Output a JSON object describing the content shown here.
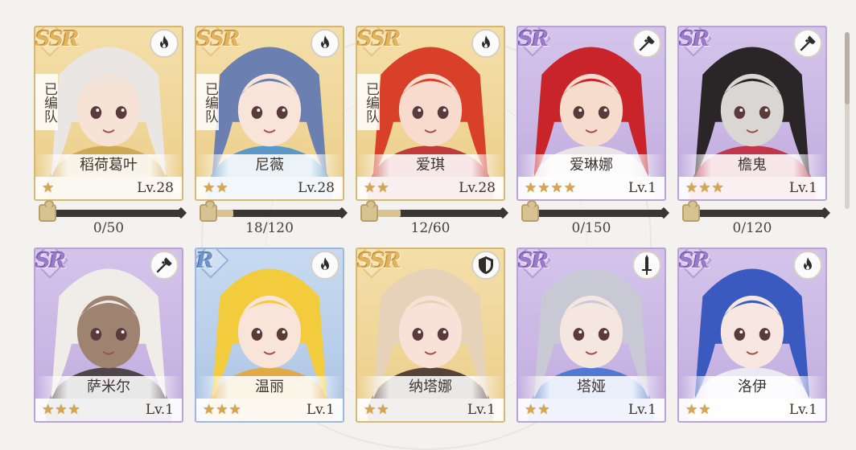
{
  "roster": [
    {
      "id": "daoheyeye",
      "name": "稻荷葛叶",
      "rarity": "SSR",
      "rarity_class": "ssr",
      "element": "fire",
      "element_icon": "flame-icon",
      "stars": 1,
      "level": "Lv.28",
      "team_tag": "已编队",
      "shard_text": "0/50",
      "shard_progress": 0,
      "hair": "#e9e6e4",
      "skin": "#f7e2d6",
      "accent": "#c9a24a"
    },
    {
      "id": "niwei",
      "name": "尼薇",
      "rarity": "SSR",
      "rarity_class": "ssr",
      "element": "fire",
      "element_icon": "flame-icon",
      "stars": 2,
      "level": "Lv.28",
      "team_tag": "已编队",
      "shard_text": "18/120",
      "shard_progress": 0.15,
      "hair": "#6b7fb0",
      "skin": "#f8e4d8",
      "accent": "#3f8fd0"
    },
    {
      "id": "aiqi",
      "name": "爱琪",
      "rarity": "SSR",
      "rarity_class": "ssr",
      "element": "fire",
      "element_icon": "flame-icon",
      "stars": 2,
      "level": "Lv.28",
      "team_tag": "已编队",
      "shard_text": "12/60",
      "shard_progress": 0.2,
      "hair": "#d8402a",
      "skin": "#f7dccd",
      "accent": "#b8202a"
    },
    {
      "id": "ailinna",
      "name": "爱琳娜",
      "rarity": "SR",
      "rarity_class": "sr",
      "element": "axe",
      "element_icon": "axe-icon",
      "stars": 4,
      "level": "Lv.1",
      "team_tag": "",
      "shard_text": "0/150",
      "shard_progress": 0,
      "hair": "#c8242a",
      "skin": "#f5dccd",
      "accent": "#f0ece6"
    },
    {
      "id": "chanhui",
      "name": "檐鬼",
      "rarity": "SR",
      "rarity_class": "sr",
      "element": "axe",
      "element_icon": "axe-icon",
      "stars": 3,
      "level": "Lv.1",
      "team_tag": "",
      "shard_text": "0/120",
      "shard_progress": 0,
      "hair": "#2a2628",
      "skin": "#d9d6d4",
      "accent": "#c02030"
    },
    {
      "id": "samier",
      "name": "萨米尔",
      "rarity": "SR",
      "rarity_class": "sr",
      "element": "axe",
      "element_icon": "axe-icon",
      "stars": 3,
      "level": "Lv.1",
      "team_tag": "",
      "hair": "#f0ede8",
      "skin": "#9e8470",
      "accent": "#3a3330"
    },
    {
      "id": "wenli",
      "name": "温丽",
      "rarity": "R",
      "rarity_class": "r",
      "element": "fire",
      "element_icon": "flame-icon",
      "stars": 3,
      "level": "Lv.1",
      "team_tag": "",
      "hair": "#f2cc3c",
      "skin": "#f8e4d8",
      "accent": "#e8a62a"
    },
    {
      "id": "natana",
      "name": "纳塔娜",
      "rarity": "SSR",
      "rarity_class": "ssr",
      "element": "shield",
      "element_icon": "shield-icon",
      "stars": 2,
      "level": "Lv.1",
      "team_tag": "",
      "hair": "#e6d2b8",
      "skin": "#f8e2d8",
      "accent": "#3a2a2a"
    },
    {
      "id": "taya",
      "name": "塔娅",
      "rarity": "SR",
      "rarity_class": "sr",
      "element": "sword",
      "element_icon": "sword-icon",
      "stars": 2,
      "level": "Lv.1",
      "team_tag": "",
      "hair": "#c9c9d6",
      "skin": "#f6e6e0",
      "accent": "#3a6fd0"
    },
    {
      "id": "luoyi",
      "name": "洛伊",
      "rarity": "SR",
      "rarity_class": "sr",
      "element": "fire",
      "element_icon": "flame-icon",
      "stars": 2,
      "level": "Lv.1",
      "team_tag": "",
      "hair": "#3a5ac0",
      "skin": "#f8e6e0",
      "accent": "#f2f2f6"
    }
  ]
}
